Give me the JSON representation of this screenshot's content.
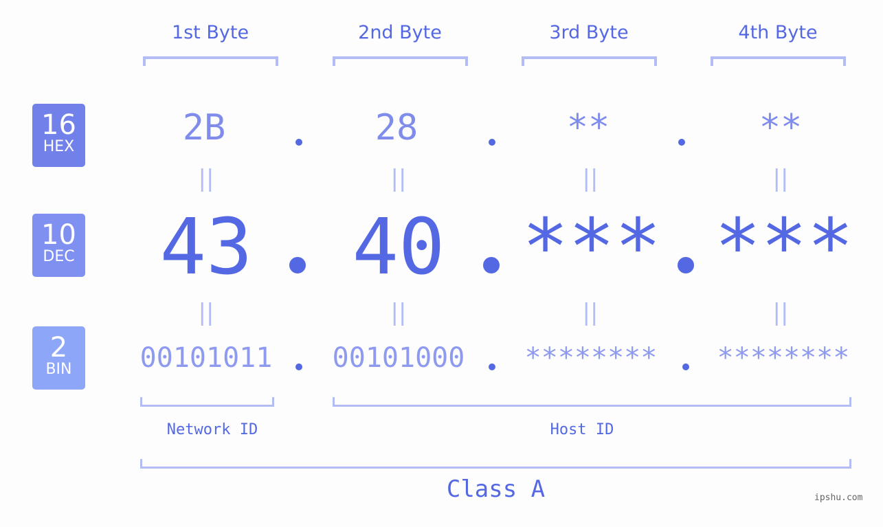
{
  "byte_headers": [
    "1st Byte",
    "2nd Byte",
    "3rd Byte",
    "4th Byte"
  ],
  "badges": {
    "hex": {
      "number": "16",
      "label": "HEX",
      "color": "#7280ea"
    },
    "dec": {
      "number": "10",
      "label": "DEC",
      "color": "#8090f0"
    },
    "bin": {
      "number": "2",
      "label": "BIN",
      "color": "#8ea6f8"
    }
  },
  "hex_values": [
    "2B",
    "28",
    "**",
    "**"
  ],
  "dec_values": [
    "43",
    "40",
    "***",
    "***"
  ],
  "bin_values": [
    "00101011",
    "00101000",
    "********",
    "********"
  ],
  "equals_glyph": "||",
  "network_label": "Network ID",
  "host_label": "Host ID",
  "class_label": "Class A",
  "watermark": "ipshu.com",
  "colors": {
    "accent": "#5468e3",
    "light": "#b3bcf5",
    "hex_text": "#7f8ceb",
    "bin_text": "#8e9af0"
  }
}
